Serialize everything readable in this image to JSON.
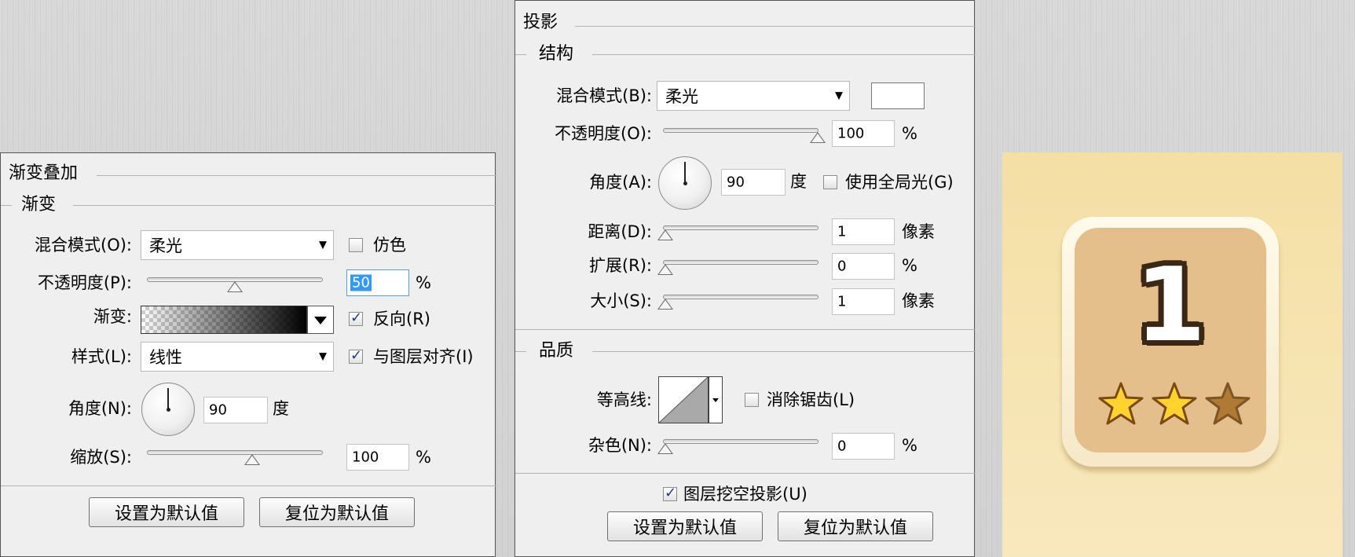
{
  "left_panel": {
    "section_title": "渐变叠加",
    "group_title": "渐变",
    "blend_mode_label": "混合模式(O):",
    "blend_mode_value": "柔光",
    "dither_label": "仿色",
    "dither_checked": false,
    "opacity_label": "不透明度(P):",
    "opacity_value": "50",
    "opacity_unit": "%",
    "opacity_level": 50,
    "gradient_label": "渐变:",
    "reverse_label": "反向(R)",
    "reverse_checked": true,
    "style_label": "样式(L):",
    "style_value": "线性",
    "align_label": "与图层对齐(I)",
    "align_checked": true,
    "angle_label": "角度(N):",
    "angle_value": "90",
    "angle_unit": "度",
    "scale_label": "缩放(S):",
    "scale_value": "100",
    "scale_unit": "%",
    "scale_level": 60,
    "default_btn": "设置为默认值",
    "reset_btn": "复位为默认值"
  },
  "mid_panel": {
    "section_title": "投影",
    "group_title": "结构",
    "blend_mode_label": "混合模式(B):",
    "blend_mode_value": "柔光",
    "shadow_color": "#ffffff",
    "opacity_label": "不透明度(O):",
    "opacity_value": "100",
    "opacity_unit": "%",
    "opacity_level": 100,
    "angle_label": "角度(A):",
    "angle_value": "90",
    "angle_unit": "度",
    "global_light_label": "使用全局光(G)",
    "global_light_checked": false,
    "distance_label": "距离(D):",
    "distance_value": "1",
    "distance_unit": "像素",
    "spread_label": "扩展(R):",
    "spread_value": "0",
    "spread_unit": "%",
    "size_label": "大小(S):",
    "size_value": "1",
    "size_unit": "像素",
    "quality_title": "品质",
    "contour_label": "等高线:",
    "antialias_label": "消除锯齿(L)",
    "antialias_checked": false,
    "noise_label": "杂色(N):",
    "noise_value": "0",
    "noise_unit": "%",
    "knockout_label": "图层挖空投影(U)",
    "knockout_checked": true,
    "default_btn": "设置为默认值",
    "reset_btn": "复位为默认值"
  },
  "preview": {
    "level_number": "1",
    "stars_earned": 2,
    "stars_total": 3,
    "bg_color": "#f6e2ad",
    "tile_color": "#e4bf8c",
    "star_gold": "#ffd22e",
    "star_brown": "#b07a35"
  }
}
